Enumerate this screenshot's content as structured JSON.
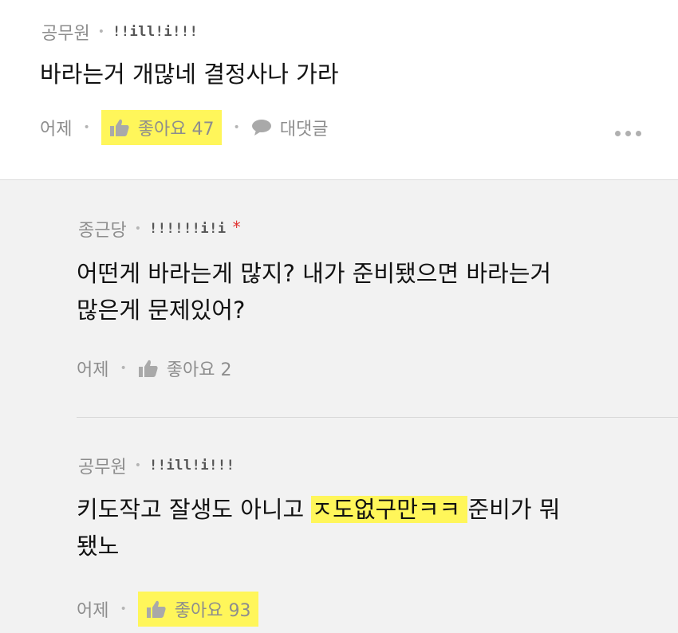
{
  "comment1": {
    "author": "공무원",
    "badge": "!!ill!i!!!",
    "text": "바라는거 개많네 결정사나 가라",
    "time": "어제",
    "like_label": "좋아요 47",
    "reply_label": "대댓글"
  },
  "reply1": {
    "author": "종근당",
    "badge": "!!!!!!i!i",
    "star": "*",
    "text_line1": "어떤게 바라는게 많지? 내가 준비됐으면 바라는거",
    "text_line2": "많은게 문제있어?",
    "time": "어제",
    "like_label": "좋아요 2"
  },
  "reply2": {
    "author": "공무원",
    "badge": "!!ill!i!!!",
    "text_line1_a": "키도작고 잘생도 아니고 ",
    "text_line1_hl": "ㅈ도없구만ㅋㅋ ",
    "text_line1_b": "준비가 뭐",
    "text_line2": "됐노",
    "time": "어제",
    "like_label": "좋아요 93"
  },
  "colors": {
    "highlight": "#fff65a",
    "meta_gray": "#8d8d8d",
    "star_red": "#e0312f"
  },
  "icons": [
    "thumbs-up-icon",
    "speech-bubble-icon",
    "more-dots-icon"
  ]
}
